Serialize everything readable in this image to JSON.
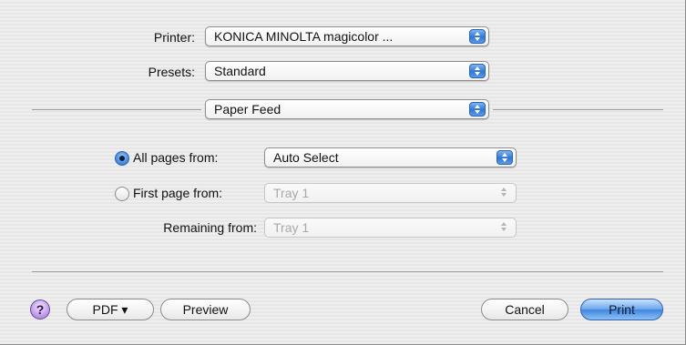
{
  "printer": {
    "label": "Printer:",
    "value": "KONICA MINOLTA magicolor ..."
  },
  "presets": {
    "label": "Presets:",
    "value": "Standard"
  },
  "panel": {
    "value": "Paper Feed"
  },
  "all_pages": {
    "label": "All pages from:",
    "value": "Auto Select",
    "selected": true
  },
  "first_page": {
    "label": "First page from:",
    "value": "Tray 1",
    "selected": false
  },
  "remaining": {
    "label": "Remaining from:",
    "value": "Tray 1"
  },
  "footer": {
    "help_label": "?",
    "pdf_label": "PDF ▾",
    "preview_label": "Preview",
    "cancel_label": "Cancel",
    "print_label": "Print"
  },
  "colors": {
    "accent": "#3f86e0",
    "help": "#b48ae0"
  },
  "icons": {
    "popup_arrows": "up-down-arrows-icon",
    "help": "help-icon"
  }
}
